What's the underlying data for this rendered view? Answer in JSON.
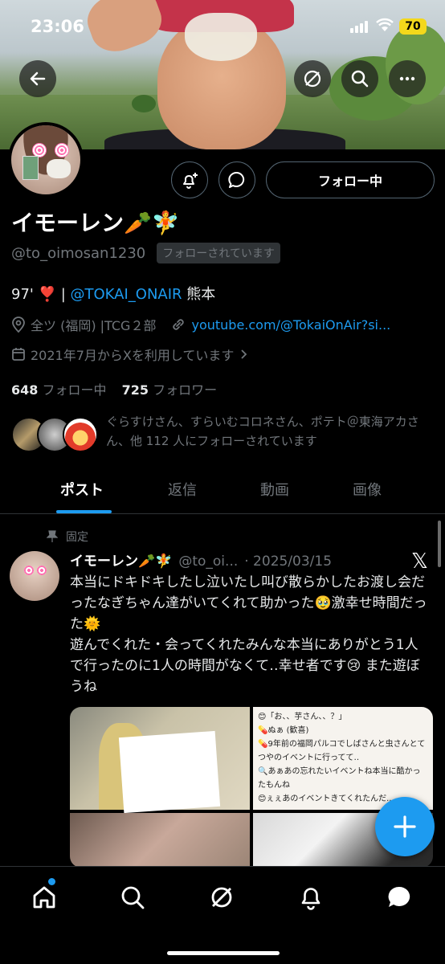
{
  "status_bar": {
    "time": "23:06",
    "battery": "70"
  },
  "profile": {
    "name": "イモーレン🥕🧚",
    "handle": "@to_oimosan1230",
    "follows_you": "フォローされています",
    "follow_button": "フォロー中",
    "bio_prefix": "97' ❣️ | ",
    "bio_mention": "@TOKAI_ONAIR",
    "bio_suffix": " 熊本",
    "location": "全ツ (福岡) |TCG２部",
    "website": "youtube.com/@TokaiOnAir?si...",
    "joined": "2021年7月からXを利用しています",
    "following_count": "648",
    "following_label": "フォロー中",
    "followers_count": "725",
    "followers_label": "フォロワー",
    "known_followers": "ぐらすけさん、すらいむコロネさん、ポテト＠東海アカさん、他 112 人にフォローされています"
  },
  "tabs": [
    {
      "label": "ポスト"
    },
    {
      "label": "返信"
    },
    {
      "label": "動画"
    },
    {
      "label": "画像"
    }
  ],
  "post": {
    "pinned_label": "固定",
    "author_name": "イモーレン🥕🧚",
    "author_handle": "@to_oi...",
    "date": "· 2025/03/15",
    "text": "本当にドキドキしたし泣いたし叫び散らかしたお渡し会だったなぎちゃん達がいてくれて助かった🥹激幸せ時間だった🌞\n遊んでくれた・会ってくれたみんな本当にありがとう1人で行ったのに1人の時間がなくて‥幸せ者です😢 また遊ぼうね",
    "media_note_lines": [
      "😊「お、、芋さん、、？」",
      "💊ぬぁ (歓喜)",
      "💊9年前の福岡パルコでしばさんと虫さんとてつやのイベントに行ってて‥",
      "🔍あぁあの忘れたいイベントね本当に酷かったもんね",
      "😊ぇぇあのイベントきてくれたんだ..."
    ]
  },
  "colors": {
    "accent": "#1d9bf0",
    "background": "#000000",
    "muted": "#71767b"
  },
  "icons": {
    "back": "arrow-left-icon",
    "grok": "grok-icon",
    "search": "search-icon",
    "more": "more-icon",
    "notify": "bell-plus-icon",
    "message": "message-bubble-icon",
    "location": "location-pin-icon",
    "link": "link-icon",
    "calendar": "calendar-icon",
    "pin": "pin-icon",
    "x_logo": "x-logo-icon",
    "compose": "plus-icon",
    "nav_home": "home-icon",
    "nav_search": "search-icon",
    "nav_grok": "grok-icon",
    "nav_notifications": "bell-icon",
    "nav_messages": "message-icon"
  }
}
